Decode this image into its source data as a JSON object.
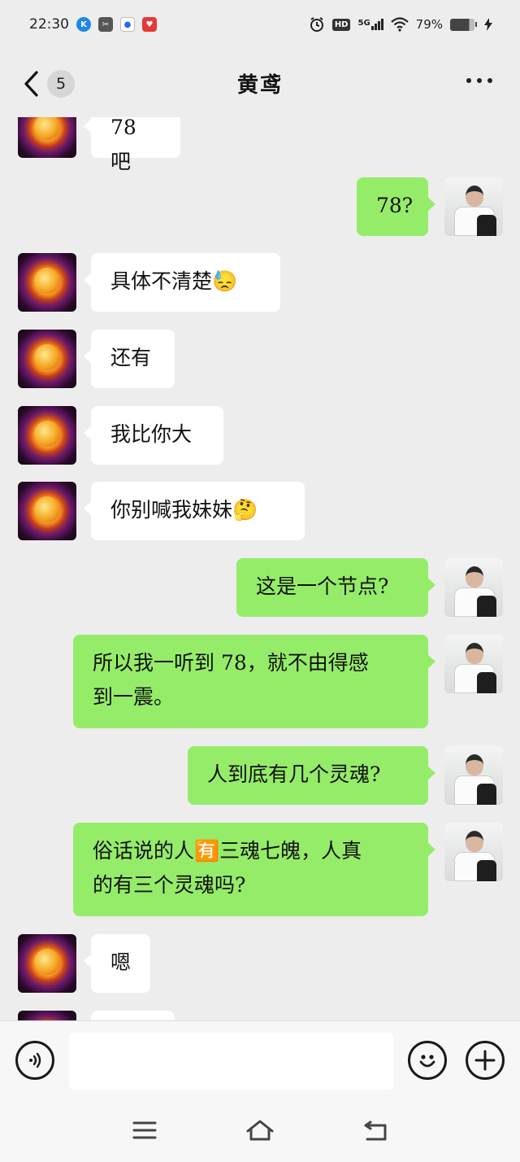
{
  "status_bar": {
    "time": "22:30",
    "hd_label": "HD",
    "network": "5G",
    "battery": "79%",
    "app_icons": [
      "kugou-icon",
      "scissors-app-icon",
      "baidu-paw-icon",
      "red-app-icon"
    ]
  },
  "header": {
    "unread_count": "5",
    "title": "黄鸢"
  },
  "messages": [
    {
      "side": "left",
      "text": "78 吧"
    },
    {
      "side": "right",
      "text": "78?"
    },
    {
      "side": "left",
      "text": "具体不清楚😓"
    },
    {
      "side": "left",
      "text": "还有"
    },
    {
      "side": "left",
      "text": "我比你大"
    },
    {
      "side": "left",
      "text": "你别喊我妹妹🤔"
    },
    {
      "side": "right",
      "text": "这是一个节点?"
    },
    {
      "side": "right",
      "text": "所以我一听到 78，就不由得感\n到一震。"
    },
    {
      "side": "right",
      "text": "人到底有几个灵魂?"
    },
    {
      "side": "right",
      "text": "俗话说的人🈶三魂七魄，人真\n的有三个灵魂吗?"
    },
    {
      "side": "left",
      "text": "嗯"
    }
  ],
  "input": {
    "placeholder": ""
  },
  "colors": {
    "background": "#ededed",
    "bubble_left": "#ffffff",
    "bubble_right": "#95ec69"
  }
}
